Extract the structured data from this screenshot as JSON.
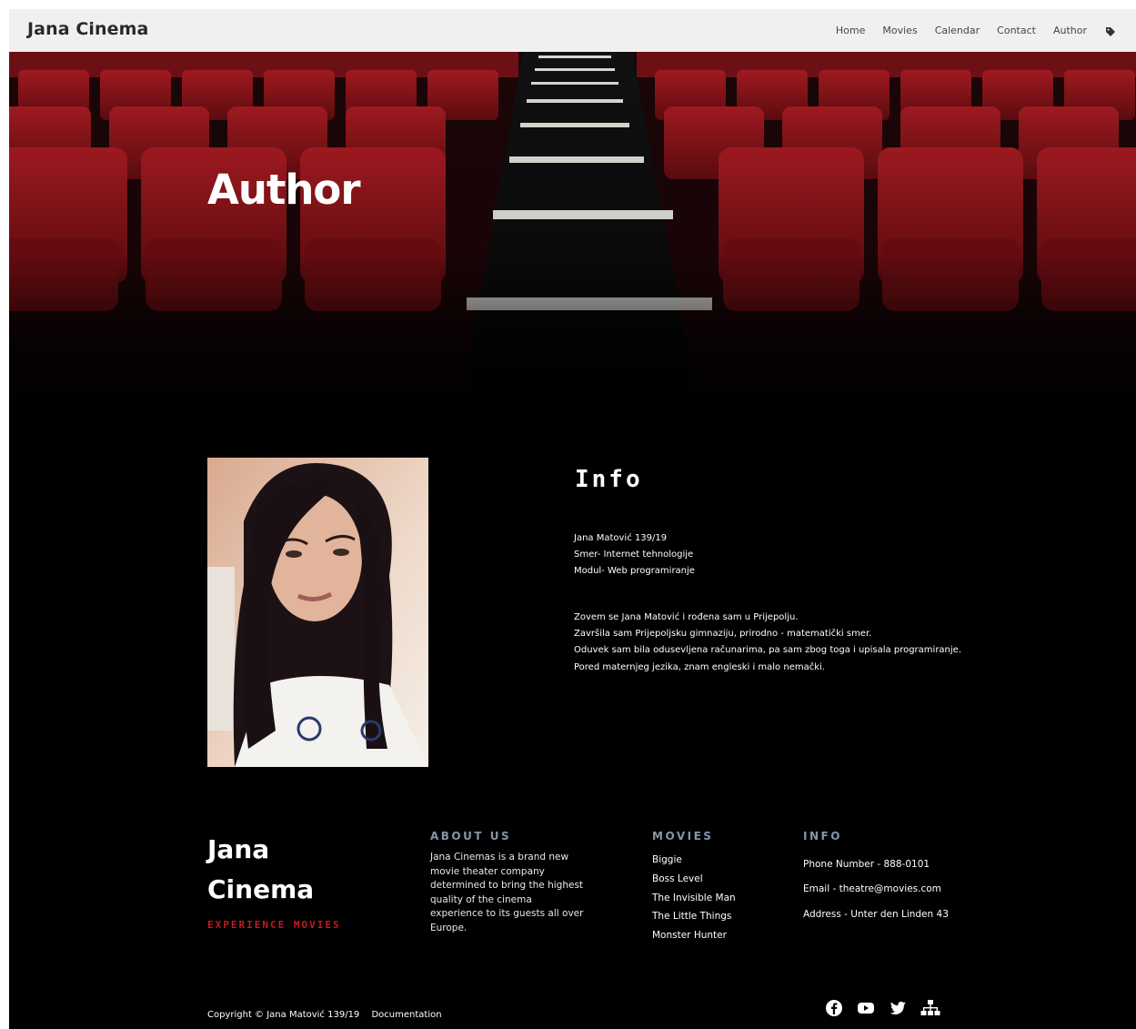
{
  "nav": {
    "brand": "Jana Cinema",
    "links": [
      "Home",
      "Movies",
      "Calendar",
      "Contact",
      "Author"
    ],
    "icon": "tag-icon"
  },
  "hero": {
    "title": "Author"
  },
  "info": {
    "title": "Info",
    "lines_a": [
      "Jana Matović 139/19",
      "Smer- Internet tehnologije",
      "Modul- Web programiranje"
    ],
    "lines_b": [
      "Zovem se Jana Matović i rođena sam u Prijepolju.",
      "Završila sam Prijepoljsku gimnaziju, prirodno - matematički smer.",
      "Oduvek sam bila odusevljena računarima, pa sam zbog toga i upisala programiranje.",
      "Pored maternjeg jezika, znam engleski i malo nemački."
    ]
  },
  "footer": {
    "brand_line1": "Jana",
    "brand_line2": "Cinema",
    "tagline": "EXPERIENCE MOVIES",
    "about_title": "ABOUT US",
    "about_text": "Jana Cinemas is a brand new movie theater company determined to bring the highest quality of the cinema experience to its guests all over Europe.",
    "movies_title": "MOVIES",
    "movies": [
      "Biggie",
      "Boss Level",
      "The Invisible Man",
      "The Little Things",
      "Monster Hunter"
    ],
    "info_title": "INFO",
    "info": [
      "Phone Number  -  888-0101",
      "Email  -  theatre@movies.com",
      "Address  -  Unter den Linden 43"
    ],
    "copyright": "Copyright © Jana Matović 139/19",
    "doc_link": "Documentation",
    "socials": [
      "facebook-icon",
      "youtube-icon",
      "twitter-icon",
      "sitemap-icon"
    ]
  },
  "colors": {
    "accent": "#c8171f",
    "heading": "#8796a8",
    "nav_bg": "#f1f0ee",
    "seat": "#8a1418"
  }
}
